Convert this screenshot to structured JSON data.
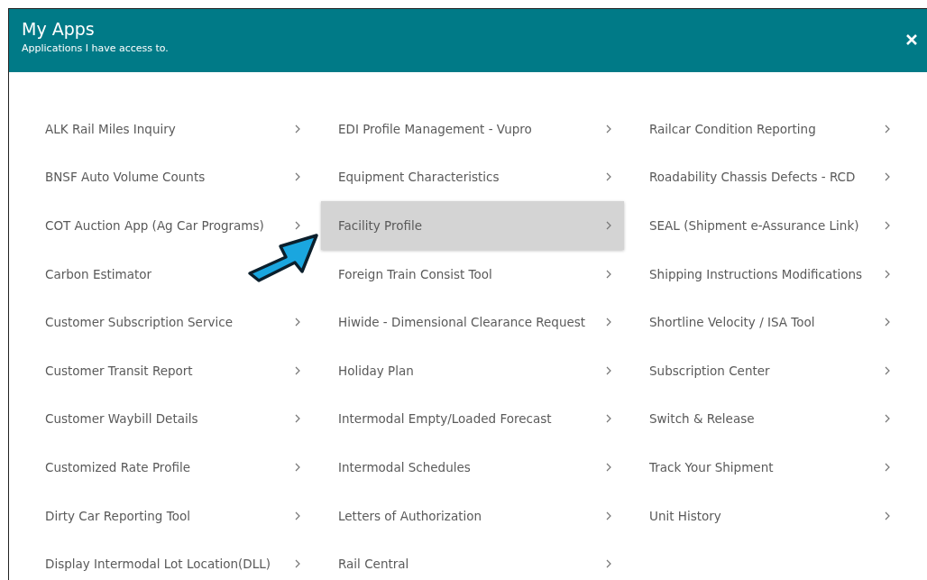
{
  "dialog": {
    "title": "My Apps",
    "subtitle": "Applications I have access to."
  },
  "columns": [
    [
      {
        "label": "ALK Rail Miles Inquiry",
        "chevron": true,
        "selected": false
      },
      {
        "label": "BNSF Auto Volume Counts",
        "chevron": true,
        "selected": false
      },
      {
        "label": "COT Auction App (Ag Car Programs)",
        "chevron": true,
        "selected": false
      },
      {
        "label": "Carbon Estimator",
        "chevron": false,
        "selected": false
      },
      {
        "label": "Customer Subscription Service",
        "chevron": true,
        "selected": false
      },
      {
        "label": "Customer Transit Report",
        "chevron": true,
        "selected": false
      },
      {
        "label": "Customer Waybill Details",
        "chevron": true,
        "selected": false
      },
      {
        "label": "Customized Rate Profile",
        "chevron": true,
        "selected": false
      },
      {
        "label": "Dirty Car Reporting Tool",
        "chevron": true,
        "selected": false
      },
      {
        "label": "Display Intermodal Lot Location(DLL)",
        "chevron": true,
        "selected": false
      }
    ],
    [
      {
        "label": "EDI Profile Management - Vupro",
        "chevron": true,
        "selected": false
      },
      {
        "label": "Equipment Characteristics",
        "chevron": true,
        "selected": false
      },
      {
        "label": "Facility Profile",
        "chevron": true,
        "selected": true
      },
      {
        "label": "Foreign Train Consist Tool",
        "chevron": true,
        "selected": false
      },
      {
        "label": "Hiwide - Dimensional Clearance Request",
        "chevron": true,
        "selected": false
      },
      {
        "label": "Holiday Plan",
        "chevron": true,
        "selected": false
      },
      {
        "label": "Intermodal Empty/Loaded Forecast",
        "chevron": true,
        "selected": false
      },
      {
        "label": "Intermodal Schedules",
        "chevron": true,
        "selected": false
      },
      {
        "label": "Letters of Authorization",
        "chevron": true,
        "selected": false
      },
      {
        "label": "Rail Central",
        "chevron": true,
        "selected": false
      }
    ],
    [
      {
        "label": "Railcar Condition Reporting",
        "chevron": true,
        "selected": false
      },
      {
        "label": "Roadability Chassis Defects - RCD",
        "chevron": true,
        "selected": false
      },
      {
        "label": "SEAL (Shipment e-Assurance Link)",
        "chevron": true,
        "selected": false
      },
      {
        "label": "Shipping Instructions Modifications",
        "chevron": true,
        "selected": false
      },
      {
        "label": "Shortline Velocity / ISA Tool",
        "chevron": true,
        "selected": false
      },
      {
        "label": "Subscription Center",
        "chevron": true,
        "selected": false
      },
      {
        "label": "Switch & Release",
        "chevron": true,
        "selected": false
      },
      {
        "label": "Track Your Shipment",
        "chevron": true,
        "selected": false
      },
      {
        "label": "Unit History",
        "chevron": true,
        "selected": false
      }
    ]
  ]
}
